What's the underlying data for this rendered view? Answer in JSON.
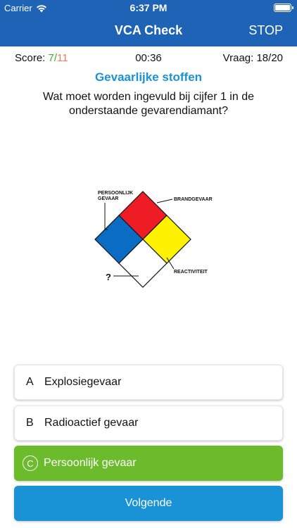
{
  "status_bar": {
    "carrier": "Carrier",
    "time": "6:37 PM"
  },
  "nav": {
    "title": "VCA Check",
    "stop_label": "STOP"
  },
  "info": {
    "score_label": "Score: ",
    "score_correct": "7",
    "score_separator": "/",
    "score_total": "11",
    "timer": "00:36",
    "vraag": "Vraag: 18/20"
  },
  "question": {
    "category": "Gevaarlijke stoffen",
    "text": "Wat moet worden ingevuld bij cijfer 1 in de onderstaande gevarendiamant?"
  },
  "diagram": {
    "label_top_left_line1": "PERSOONLIJK",
    "label_top_left_line2": "GEVAAR",
    "label_top_right": "BRANDGEVAAR",
    "label_right": "REACTIVITEIT",
    "label_bottom": "?",
    "colors": {
      "top": "#ee1c25",
      "left": "#0a6cc2",
      "right": "#fff200",
      "bottom": "#ffffff"
    }
  },
  "answers": [
    {
      "letter": "A",
      "text": "Explosiegevaar",
      "state": "default"
    },
    {
      "letter": "B",
      "text": "Radioactief gevaar",
      "state": "default"
    },
    {
      "letter": "C",
      "text": "Persoonlijk gevaar",
      "state": "correct"
    }
  ],
  "next_label": "Volgende",
  "colors": {
    "header": "#1e63b6",
    "accent": "#1a92d6",
    "correct": "#6cbb2d",
    "wrong_count": "#f27a5e"
  }
}
